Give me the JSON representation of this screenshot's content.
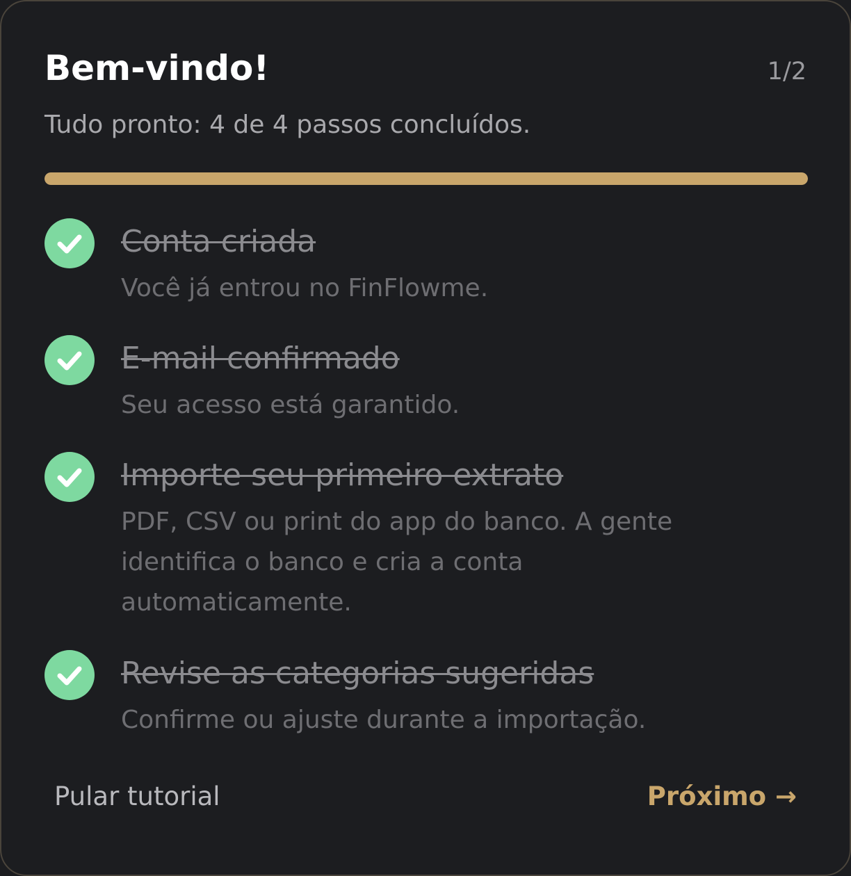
{
  "header": {
    "title": "Bem-vindo!",
    "page_counter": "1/2",
    "subtitle": "Tudo pronto: 4 de 4 passos concluídos."
  },
  "progress": {
    "completed": 4,
    "total": 4,
    "fraction": 1.0
  },
  "steps": [
    {
      "title": "Conta criada",
      "description": "Você já entrou no FinFlowme.",
      "done": true,
      "icon": "check-icon"
    },
    {
      "title": "E-mail confirmado",
      "description": "Seu acesso está garantido.",
      "done": true,
      "icon": "check-icon"
    },
    {
      "title": "Importe seu primeiro extrato",
      "description": "PDF, CSV ou print do app do banco. A gente identifica o banco e cria a conta automaticamente.",
      "done": true,
      "icon": "check-icon"
    },
    {
      "title": "Revise as categorias sugeridas",
      "description": "Confirme ou ajuste durante a importação.",
      "done": true,
      "icon": "check-icon"
    }
  ],
  "footer": {
    "skip_label": "Pular tutorial",
    "next_label": "Próximo →"
  },
  "colors": {
    "accent": "#c9a66b",
    "success": "#7ed9a0",
    "background": "#1c1d20",
    "border": "#4a443b"
  }
}
